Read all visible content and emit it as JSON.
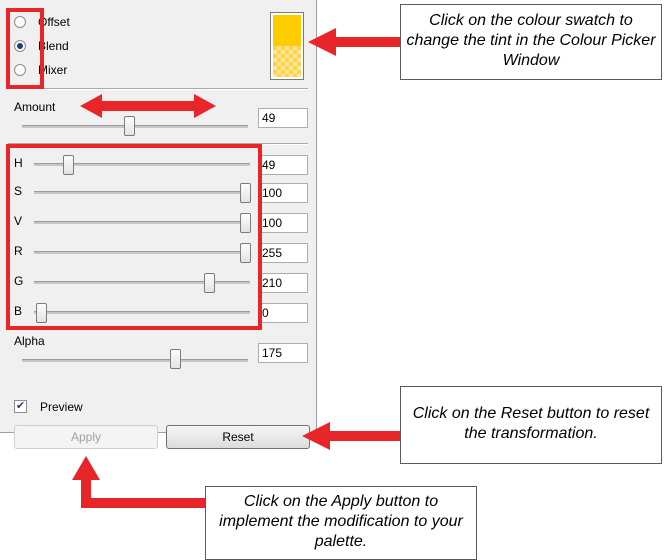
{
  "mode_options": [
    {
      "label": "Offset",
      "checked": false
    },
    {
      "label": "Blend",
      "checked": true
    },
    {
      "label": "Mixer",
      "checked": false
    }
  ],
  "swatch": {
    "colour": "#ffcc00"
  },
  "amount": {
    "label": "Amount",
    "value": "49"
  },
  "sliders": [
    {
      "label": "H",
      "value": "49"
    },
    {
      "label": "S",
      "value": "100"
    },
    {
      "label": "V",
      "value": "100"
    },
    {
      "label": "R",
      "value": "255"
    },
    {
      "label": "G",
      "value": "210"
    },
    {
      "label": "B",
      "value": "0"
    }
  ],
  "alpha": {
    "label": "Alpha",
    "value": "175"
  },
  "preview": {
    "label": "Preview",
    "checked": true
  },
  "buttons": {
    "apply": "Apply",
    "reset": "Reset"
  },
  "callouts": {
    "swatch": "Click on the colour swatch to change the tint in the Colour Picker Window",
    "reset": "Click on the Reset button to reset the transformation.",
    "apply": "Click on the Apply button to implement the modification to your palette."
  },
  "colors": {
    "highlight_red": "#e8262a",
    "radio_dot": "#1d3e7a"
  }
}
